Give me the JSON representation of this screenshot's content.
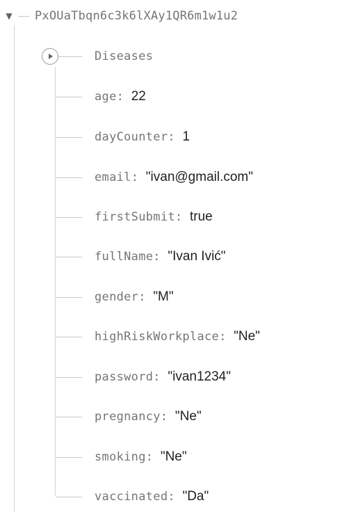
{
  "root": {
    "toggle_icon": "caret-down-icon",
    "key": "PxOUaTbqn6c3k6lXAy1QR6m1w1u2"
  },
  "collection": {
    "expander_icon": "caret-right-icon",
    "label": "Diseases"
  },
  "fields": [
    {
      "key": "age",
      "value": "22"
    },
    {
      "key": "dayCounter",
      "value": "1"
    },
    {
      "key": "email",
      "value": "\"ivan@gmail.com\""
    },
    {
      "key": "firstSubmit",
      "value": "true"
    },
    {
      "key": "fullName",
      "value": "\"Ivan Ivić\""
    },
    {
      "key": "gender",
      "value": "\"M\""
    },
    {
      "key": "highRiskWorkplace",
      "value": "\"Ne\""
    },
    {
      "key": "password",
      "value": "\"ivan1234\""
    },
    {
      "key": "pregnancy",
      "value": "\"Ne\""
    },
    {
      "key": "smoking",
      "value": "\"Ne\""
    },
    {
      "key": "vaccinated",
      "value": "\"Da\""
    }
  ],
  "separator": ":"
}
